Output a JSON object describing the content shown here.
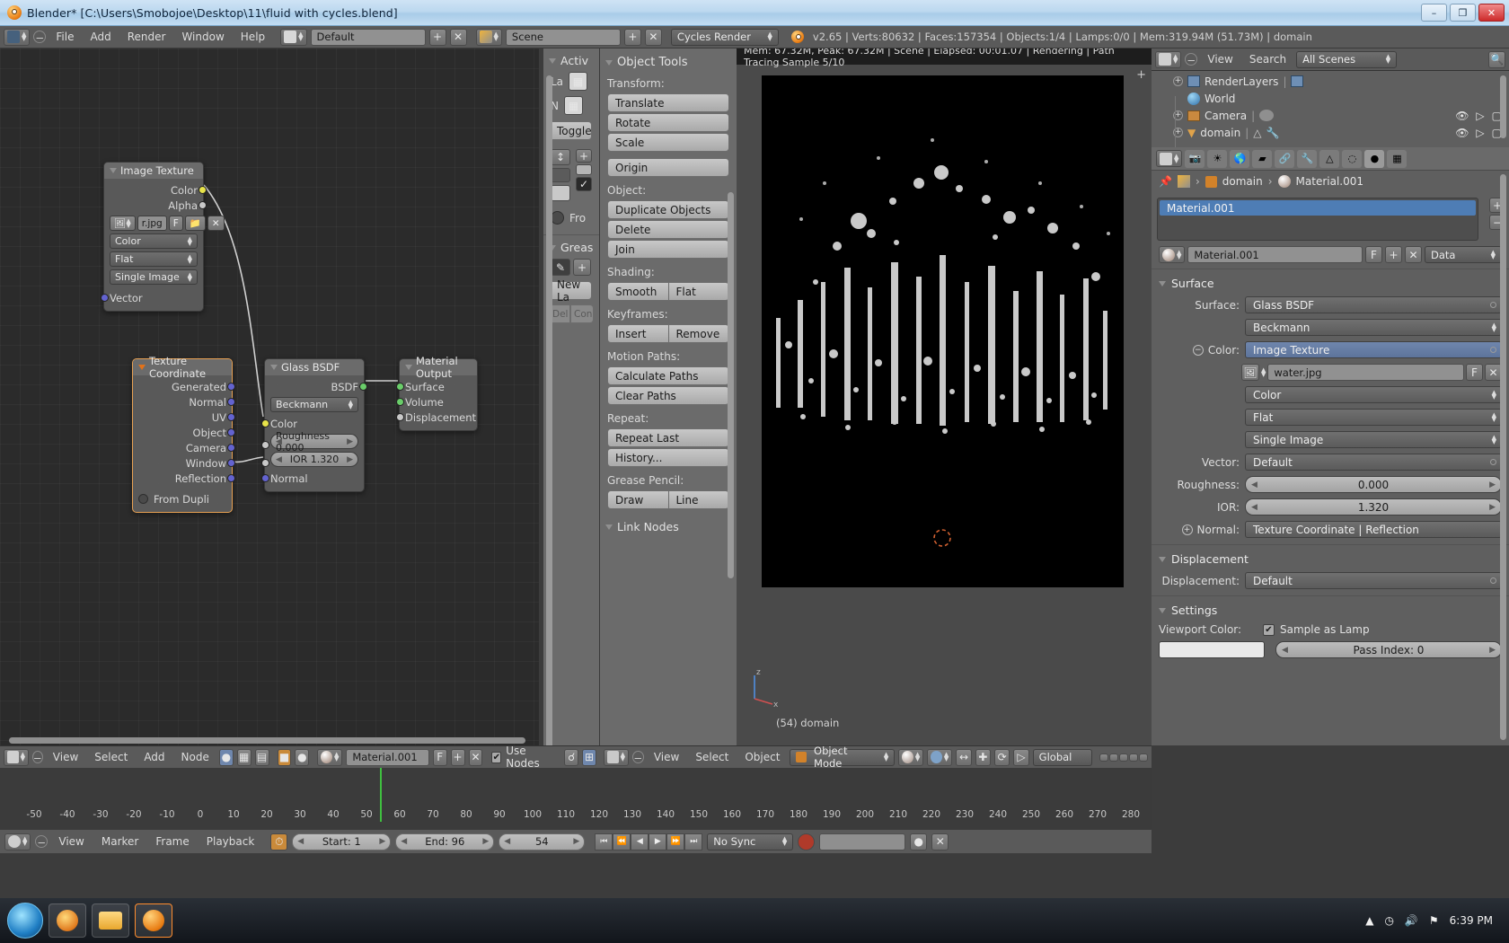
{
  "window": {
    "title": "Blender* [C:\\Users\\Smobojoe\\Desktop\\11\\fluid with cycles.blend]",
    "minimize": "–",
    "maximize": "❐",
    "close": "✕"
  },
  "topbar": {
    "menus": [
      "File",
      "Add",
      "Render",
      "Window",
      "Help"
    ],
    "screen_layout": "Default",
    "scene_name": "Scene",
    "engine": "Cycles Render",
    "add_icon": "+",
    "remove_icon": "✕",
    "status": "v2.65 | Verts:80632 | Faces:157354 | Objects:1/4 | Lamps:0/0 | Mem:319.94M (51.73M) | domain"
  },
  "node_editor": {
    "header": {
      "menus": [
        "View",
        "Select",
        "Add",
        "Node"
      ],
      "material_name": "Material.001",
      "fake_user": "F",
      "add_icon": "+",
      "remove_icon": "✕",
      "use_nodes_label": "Use Nodes",
      "use_nodes_checked": "✔"
    },
    "nodes": [
      {
        "title": "Image Texture",
        "outputs": [
          "Color",
          "Alpha"
        ],
        "image_name": "r.jpg",
        "fake_user": "F",
        "dropdowns": [
          "Color",
          "Flat",
          "Single Image"
        ],
        "inputs": [
          "Vector"
        ]
      },
      {
        "title": "Texture Coordinate",
        "outputs": [
          "Generated",
          "Normal",
          "UV",
          "Object",
          "Camera",
          "Window",
          "Reflection"
        ],
        "option": "From Dupli"
      },
      {
        "title": "Glass BSDF",
        "outputs": [
          "BSDF"
        ],
        "distribution": "Beckmann",
        "inputs": [
          "Color",
          "Roughness 0.000",
          "IOR 1.320",
          "Normal"
        ]
      },
      {
        "title": "Material Output",
        "inputs": [
          "Surface",
          "Volume",
          "Displacement"
        ]
      }
    ]
  },
  "toolshelf": {
    "active_panel": "Activ",
    "layer_label": "La",
    "n_label": "N",
    "toggle_label": "Toggle",
    "front_label": "Fro",
    "grease_panel": "Greas",
    "new_layer": "New La",
    "del_label": "Del",
    "con_label": "Con"
  },
  "object_tools": {
    "panel_title": "Object Tools",
    "sections": [
      {
        "label": "Transform:",
        "buttons": [
          "Translate",
          "Rotate",
          "Scale"
        ]
      },
      {
        "label": "",
        "buttons": [
          "Origin"
        ]
      },
      {
        "label": "Object:",
        "buttons": [
          "Duplicate Objects",
          "Delete",
          "Join"
        ]
      },
      {
        "label": "Shading:",
        "pair": [
          "Smooth",
          "Flat"
        ]
      },
      {
        "label": "Keyframes:",
        "pair": [
          "Insert",
          "Remove"
        ]
      },
      {
        "label": "Motion Paths:",
        "buttons": [
          "Calculate Paths",
          "Clear Paths"
        ]
      },
      {
        "label": "Repeat:",
        "buttons": [
          "Repeat Last",
          "History..."
        ]
      },
      {
        "label": "Grease Pencil:",
        "pair": [
          "Draw",
          "Line"
        ]
      }
    ],
    "link_nodes": "Link Nodes"
  },
  "view3d": {
    "render_status": "Mem: 67.32M, Peak: 67.32M | Scene | Elapsed: 00:01.07 | Rendering | Path Tracing Sample 5/10",
    "object_label": "(54) domain",
    "axis_z": "z",
    "axis_x": "x",
    "header": {
      "menus": [
        "View",
        "Select",
        "Object"
      ],
      "mode": "Object Mode",
      "transform_orientation": "Global"
    }
  },
  "outliner": {
    "header": {
      "view": "View",
      "search": "Search",
      "scope": "All Scenes"
    },
    "items": [
      {
        "label": "RenderLayers",
        "icon": "renderlayers-icon",
        "expandable": true
      },
      {
        "label": "World",
        "icon": "world-icon",
        "expandable": false
      },
      {
        "label": "Camera",
        "icon": "camera-icon",
        "expandable": true
      },
      {
        "label": "domain",
        "icon": "mesh-icon",
        "expandable": true
      }
    ]
  },
  "properties": {
    "breadcrumb": [
      "domain",
      "Material.001"
    ],
    "material_slot": "Material.001",
    "datablock_name": "Material.001",
    "fake_user": "F",
    "add_icon": "+",
    "remove_icon": "✕",
    "data_menu": "Data",
    "surface_section": {
      "title": "Surface",
      "surface_label": "Surface:",
      "surface_value": "Glass BSDF",
      "distribution_value": "Beckmann",
      "color_label": "Color:",
      "color_value": "Image Texture",
      "image_name": "water.jpg",
      "image_fake_user": "F",
      "image_remove": "✕",
      "color_space": "Color",
      "projection": "Flat",
      "source": "Single Image",
      "vector_label": "Vector:",
      "vector_value": "Default",
      "roughness_label": "Roughness:",
      "roughness_value": "0.000",
      "ior_label": "IOR:",
      "ior_value": "1.320",
      "normal_label": "Normal:",
      "normal_value": "Texture Coordinate | Reflection"
    },
    "displacement_section": {
      "title": "Displacement",
      "label": "Displacement:",
      "value": "Default"
    },
    "settings_section": {
      "title": "Settings",
      "viewport_color_label": "Viewport Color:",
      "sample_as_lamp_label": "Sample as Lamp",
      "sample_as_lamp_checked": "✔",
      "pass_index_label": "Pass Index: 0"
    }
  },
  "timeline": {
    "ticks": [
      "-50",
      "-40",
      "-30",
      "-20",
      "-10",
      "0",
      "10",
      "20",
      "30",
      "40",
      "50",
      "60",
      "70",
      "80",
      "90",
      "100",
      "110",
      "120",
      "130",
      "140",
      "150",
      "160",
      "170",
      "180",
      "190",
      "200",
      "210",
      "220",
      "230",
      "240",
      "250",
      "260",
      "270",
      "280"
    ],
    "menus": [
      "View",
      "Marker",
      "Frame",
      "Playback"
    ],
    "start": "Start: 1",
    "end": "End: 96",
    "current_frame": "54",
    "sync_mode": "No Sync",
    "transport": [
      "⏮",
      "⏪",
      "◀",
      "▶",
      "⏩",
      "⏭"
    ]
  },
  "taskbar": {
    "clock": "6:39 PM",
    "items": [
      "browser-icon",
      "explorer-icon",
      "blender-icon"
    ]
  },
  "colors": {
    "accent_blue": "#4e7db5",
    "node_selected": "#e7a153",
    "playhead_green": "#3fbf3f",
    "socket_yellow": "#e7e34a",
    "socket_blue": "#6363d0",
    "socket_green": "#6acd6a",
    "socket_grey": "#c8c8c8"
  }
}
